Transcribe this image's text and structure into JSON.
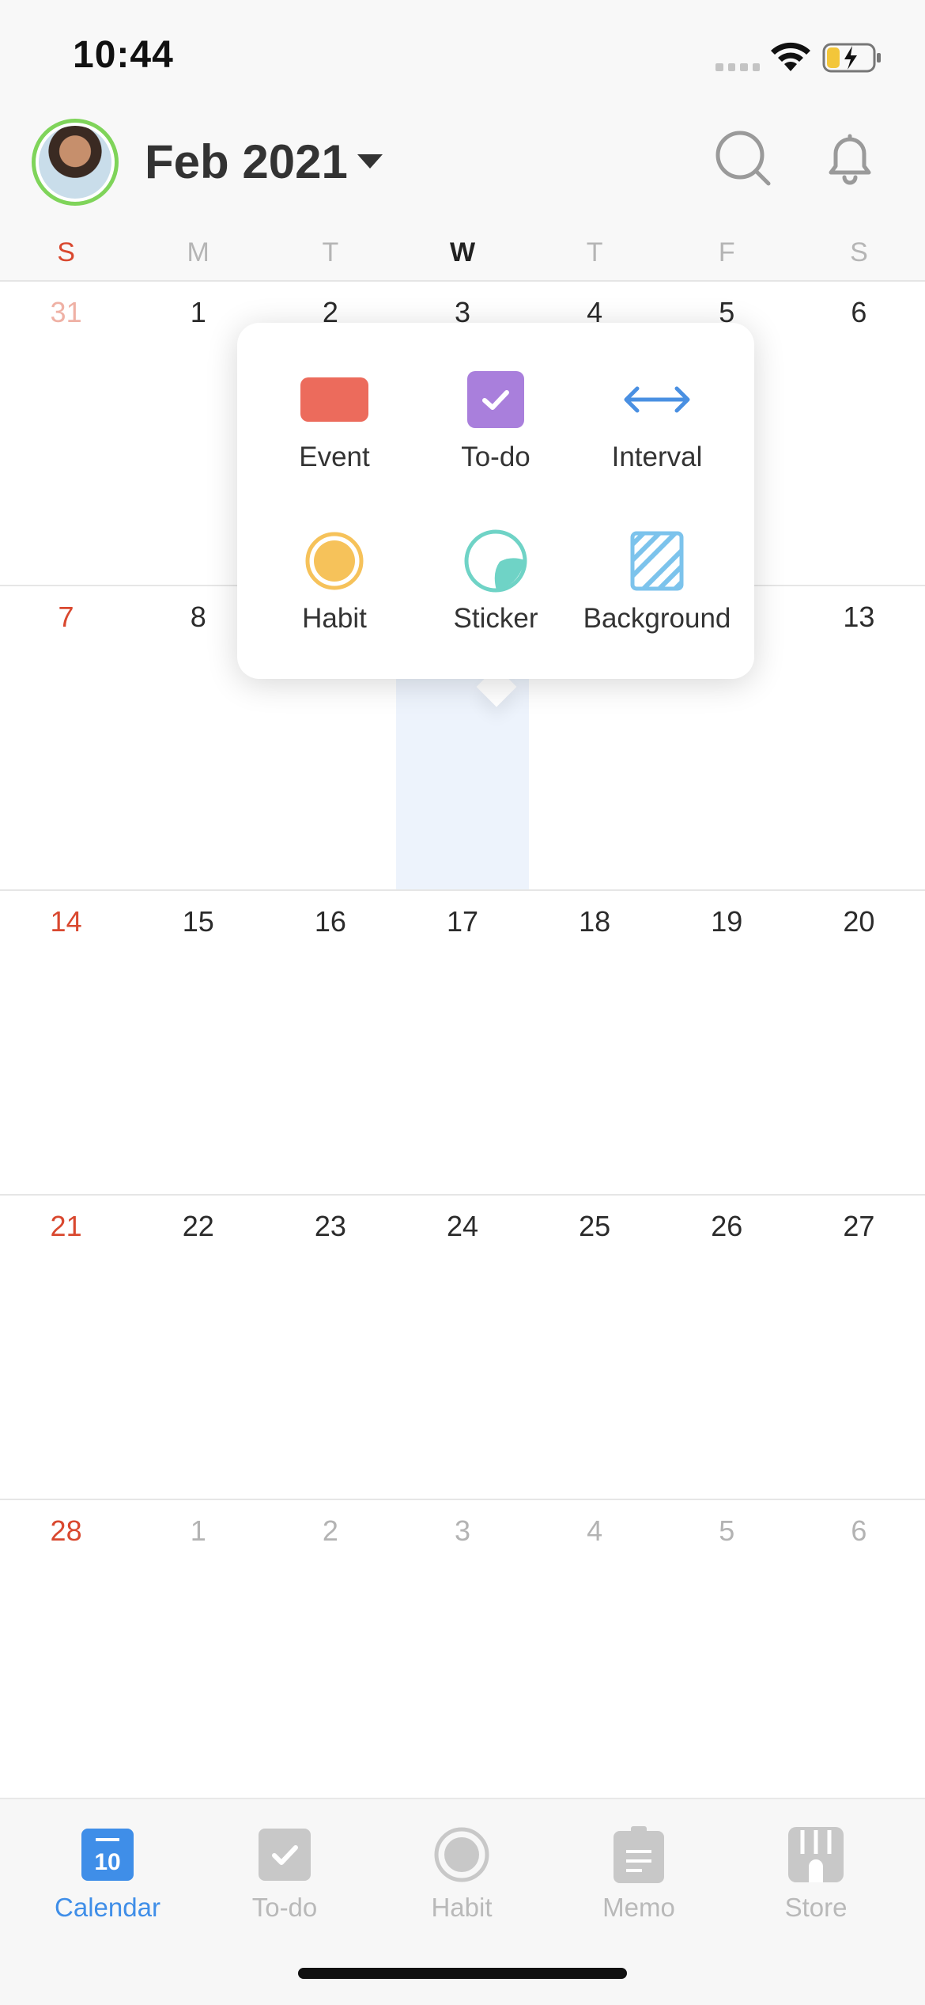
{
  "status_bar": {
    "time": "10:44"
  },
  "header": {
    "month": "Feb 2021"
  },
  "weekdays": [
    "S",
    "M",
    "T",
    "W",
    "T",
    "F",
    "S"
  ],
  "weeks": [
    [
      "31",
      "1",
      "2",
      "3",
      "4",
      "5",
      "6"
    ],
    [
      "7",
      "8",
      "",
      "",
      "",
      "",
      "13"
    ],
    [
      "14",
      "15",
      "16",
      "17",
      "18",
      "19",
      "20"
    ],
    [
      "21",
      "22",
      "23",
      "24",
      "25",
      "26",
      "27"
    ],
    [
      "28",
      "1",
      "2",
      "3",
      "4",
      "5",
      "6"
    ]
  ],
  "popup": {
    "options": [
      "Event",
      "To-do",
      "Interval",
      "Habit",
      "Sticker",
      "Background"
    ]
  },
  "tabs": [
    "Calendar",
    "To-do",
    "Habit",
    "Memo",
    "Store"
  ],
  "calendar_icon_day": "10",
  "colors": {
    "accent": "#3f8ee8",
    "sunday": "#d9482f",
    "event": "#ec6b5c",
    "todo": "#a97fdc",
    "interval": "#4a90e2",
    "habit": "#f6c25a",
    "sticker": "#6fd3c6",
    "background": "#7cc3ec"
  }
}
